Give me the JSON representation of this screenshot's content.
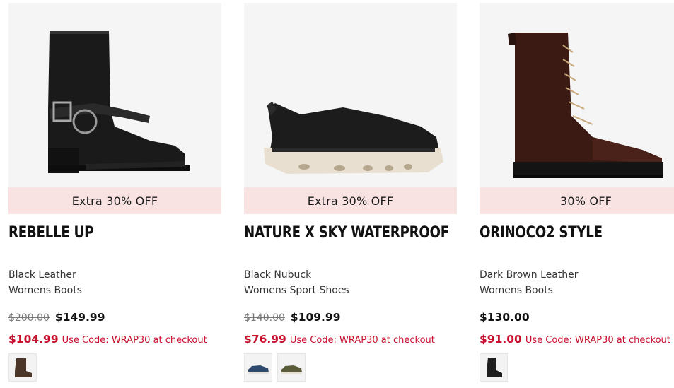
{
  "products": [
    {
      "name": "REBELLE UP",
      "promo": "Extra 30% OFF",
      "color": "Black Leather",
      "category": "Womens Boots",
      "was_price": "$200.00",
      "price": "$149.99",
      "code_price": "$104.99",
      "code_text": "Use Code: WRAP30 at checkout",
      "swatch_colors": [
        "#4a3528"
      ]
    },
    {
      "name": "NATURE X SKY WATERPROOF",
      "promo": "Extra 30% OFF",
      "color": "Black Nubuck",
      "category": "Womens Sport Shoes",
      "was_price": "$140.00",
      "price": "$109.99",
      "code_price": "$76.99",
      "code_text": "Use Code: WRAP30 at checkout",
      "swatch_colors": [
        "#2d4a6e",
        "#5a5c3a"
      ]
    },
    {
      "name": "ORINOCO2 STYLE",
      "promo": "30% OFF",
      "color": "Dark Brown Leather",
      "category": "Womens Boots",
      "was_price": "",
      "price": "$130.00",
      "code_price": "$91.00",
      "code_text": "Use Code: WRAP30 at checkout",
      "swatch_colors": [
        "#1e1e1e"
      ]
    }
  ],
  "theme": {
    "promo_bg": "#f9e2e2",
    "sale_red": "#c8102e",
    "image_bg": "#f5f5f5"
  }
}
